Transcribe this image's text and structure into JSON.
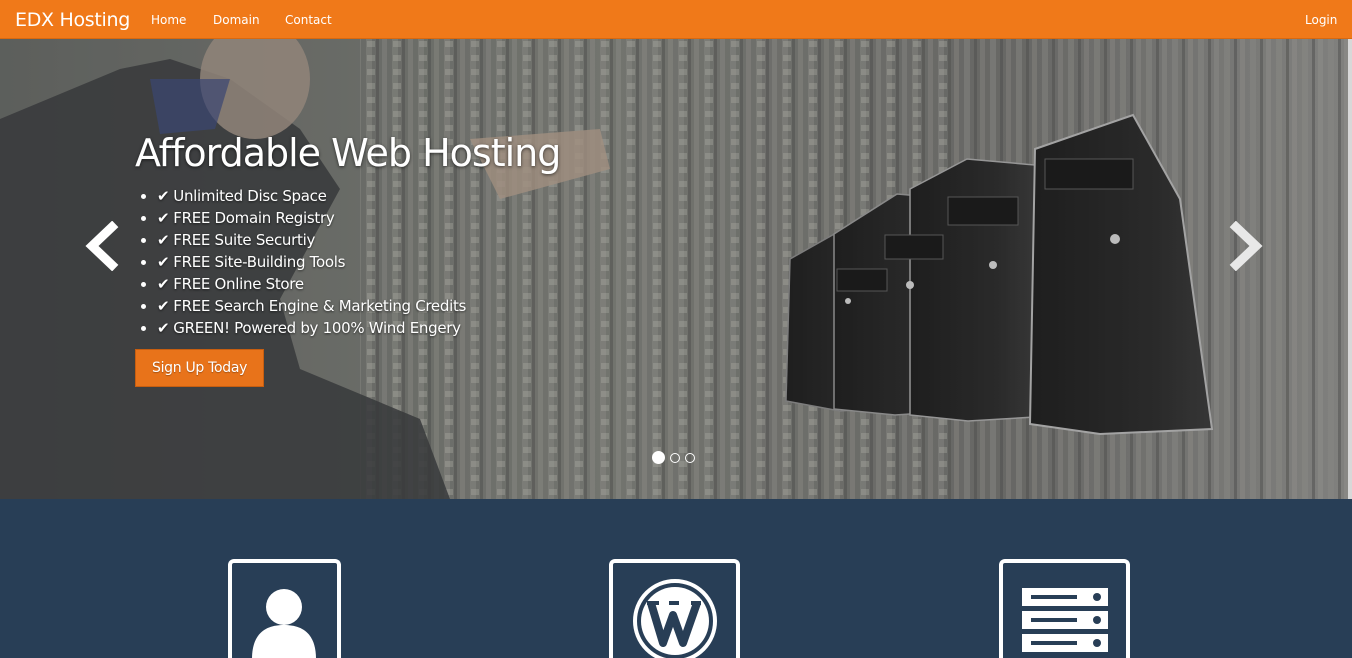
{
  "navbar": {
    "brand": "EDX Hosting",
    "links": [
      "Home",
      "Domain",
      "Contact"
    ],
    "login": "Login"
  },
  "hero": {
    "title": "Affordable Web Hosting",
    "check_icon": "check-icon",
    "features": [
      "Unlimited Disc Space",
      "FREE Domain Registry",
      "FREE Suite Securtiy",
      "FREE Site-Building Tools",
      "FREE Online Store",
      "FREE Search Engine & Marketing Credits",
      "GREEN! Powered by 100% Wind Engery"
    ],
    "cta": "Sign Up Today",
    "slides_count": 3,
    "active_slide": 1
  },
  "feature_icons": [
    "user-icon",
    "wordpress-icon",
    "server-icon"
  ],
  "colors": {
    "brand_orange": "#f07919",
    "navy": "#283e56",
    "button_orange": "#e8731a"
  }
}
